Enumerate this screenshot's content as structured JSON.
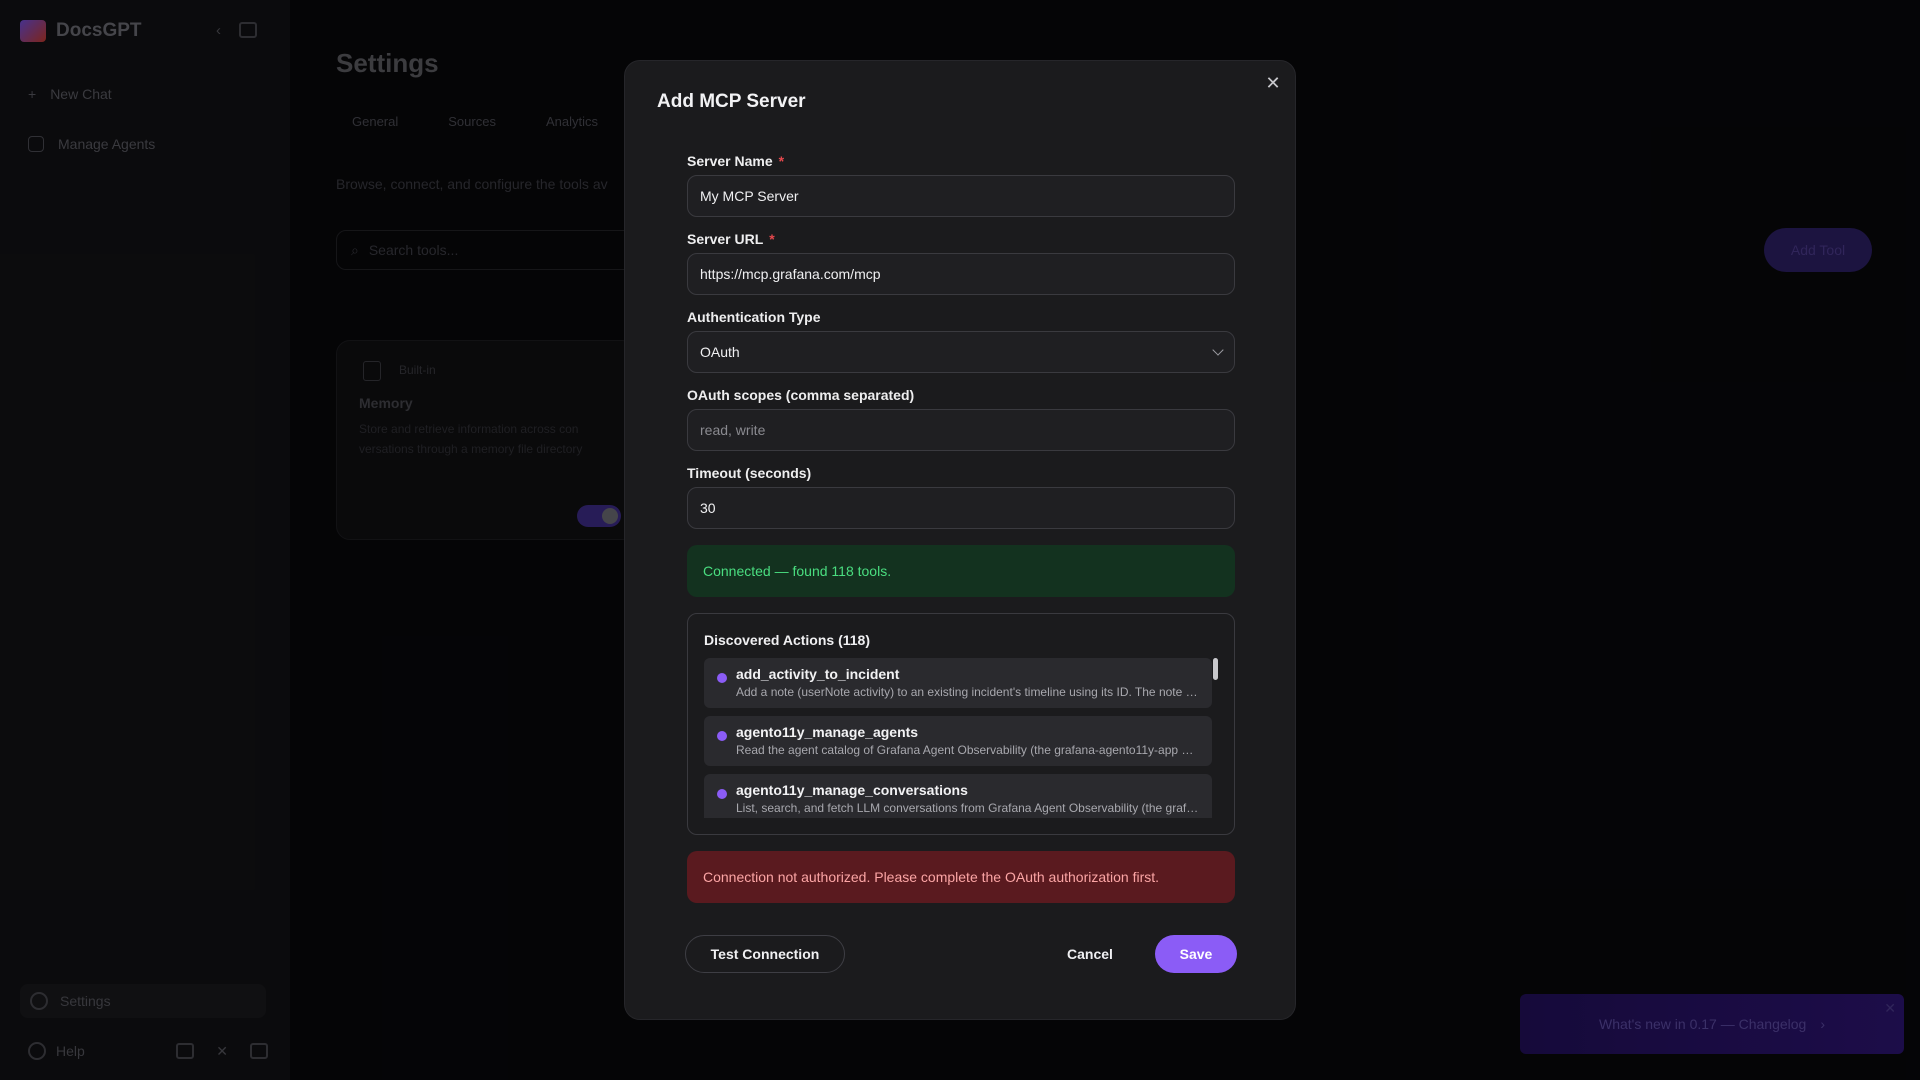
{
  "app": {
    "name": "DocsGPT"
  },
  "sidebar": {
    "items": [
      {
        "label": "New Chat",
        "icon": "plus-icon"
      },
      {
        "label": "Manage Agents",
        "icon": "agents-icon"
      }
    ],
    "settings_label": "Settings",
    "help_label": "Help"
  },
  "main": {
    "title": "Settings",
    "tabs": [
      "General",
      "Sources",
      "Analytics"
    ],
    "description": "Browse, connect, and configure the tools av",
    "search_placeholder": "Search tools...",
    "add_tool_label": "Add Tool",
    "tool_card": {
      "tag": "Built-in",
      "name": "Memory",
      "description": "Store and retrieve information across con versations through a memory file directory"
    }
  },
  "promo": {
    "text": "What's new in 0.17 — Changelog"
  },
  "modal": {
    "title": "Add MCP Server",
    "server_name": {
      "label": "Server Name",
      "value": "My MCP Server",
      "required": true
    },
    "server_url": {
      "label": "Server URL",
      "value": "https://mcp.grafana.com/mcp",
      "required": true
    },
    "auth_type": {
      "label": "Authentication Type",
      "value": "OAuth"
    },
    "oauth_scopes": {
      "label": "OAuth scopes (comma separated)",
      "value": "",
      "placeholder": "read, write"
    },
    "timeout": {
      "label": "Timeout (seconds)",
      "value": "30"
    },
    "success_message": "Connected — found 118 tools.",
    "discovered": {
      "title": "Discovered Actions (118)",
      "actions": [
        {
          "name": "add_activity_to_incident",
          "description": "Add a note (userNote activity) to an existing incident's timeline using its ID. The note content ..."
        },
        {
          "name": "agento11y_manage_agents",
          "description": "Read the agent catalog of Grafana Agent Observability (the grafana-agento11y-app plugin) ..."
        },
        {
          "name": "agento11y_manage_conversations",
          "description": "List, search, and fetch LLM conversations from Grafana Agent Observability (the grafana ..."
        }
      ]
    },
    "error_message": "Connection not authorized. Please complete the OAuth authorization first.",
    "buttons": {
      "test": "Test Connection",
      "cancel": "Cancel",
      "save": "Save"
    }
  },
  "colors": {
    "accent": "#8b5cf6",
    "success_text": "#4ade80",
    "error_text": "#fca5a5",
    "required": "#e5484d"
  }
}
